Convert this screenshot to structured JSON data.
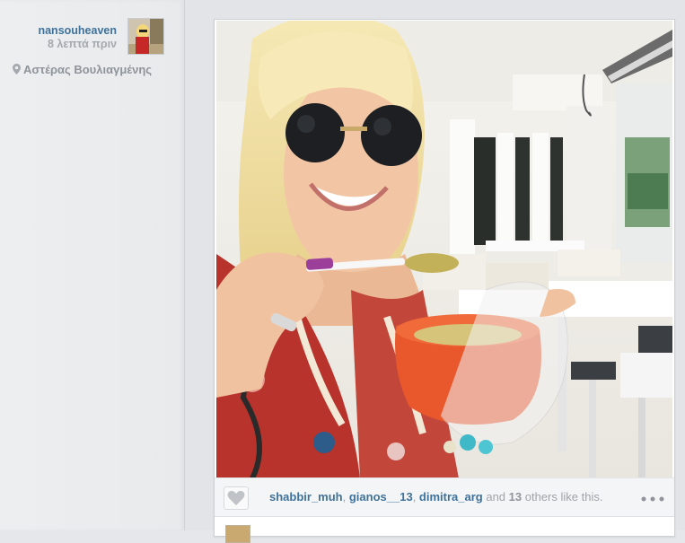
{
  "post": {
    "username": "nansouheaven",
    "time_ago": "8 λεπτά πριν",
    "location": "Αστέρας Βουλιαγμένης"
  },
  "likes": {
    "users": [
      "shabbir_muh",
      "gianos__13",
      "dimitra_arg"
    ],
    "sep1": ", ",
    "sep2": ", ",
    "and_text": " and ",
    "others_count": "13",
    "others_text": " others like this."
  },
  "icons": {
    "heart": "heart-icon",
    "more": "more-dots-icon",
    "location": "location-pin-icon"
  },
  "colors": {
    "link": "#3f729b",
    "muted": "#a4a9ae",
    "background": "#e5e7ea"
  }
}
